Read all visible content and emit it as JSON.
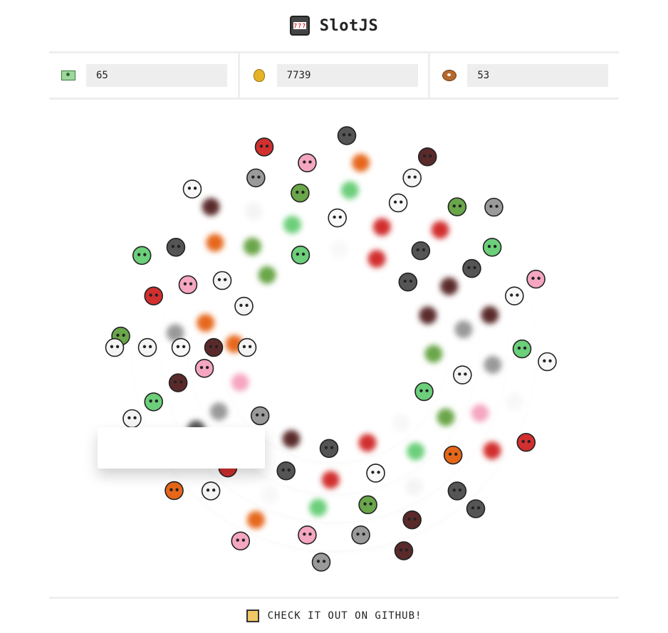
{
  "app": {
    "title": "SlotJS",
    "logo_icon": "slot-machine-icon"
  },
  "stats": [
    {
      "name": "cash",
      "icon": "cash-icon",
      "value": "65"
    },
    {
      "name": "money-bag",
      "icon": "money-bag-icon",
      "value": "7739"
    },
    {
      "name": "donut",
      "icon": "donut-icon",
      "value": "53"
    }
  ],
  "symbols": {
    "skull": {
      "glyph": "💀",
      "color": "#f4f4f4"
    },
    "ghost": {
      "glyph": "👻",
      "color": "#f8f8f8"
    },
    "vampire": {
      "glyph": "🧛",
      "color": "#5a2a2a"
    },
    "pumpkin": {
      "glyph": "🎃",
      "color": "#e6671a"
    },
    "alien": {
      "glyph": "👽",
      "color": "#6ccf7a"
    },
    "moon": {
      "glyph": "🌚",
      "color": "#555555"
    },
    "brain": {
      "glyph": "🧠",
      "color": "#f5a6c0"
    },
    "zombie": {
      "glyph": "🧟",
      "color": "#6aa64a"
    },
    "ogre": {
      "glyph": "👹",
      "color": "#d22f2f"
    },
    "werewolf": {
      "glyph": "🐺",
      "color": "#9a9a9a"
    }
  },
  "win_line": [
    "skull",
    "skull",
    "ghost",
    "vampire",
    "skull"
  ],
  "footer": {
    "link_text": "CHECK IT OUT ON GITHUB!",
    "icon": "github-icon"
  }
}
